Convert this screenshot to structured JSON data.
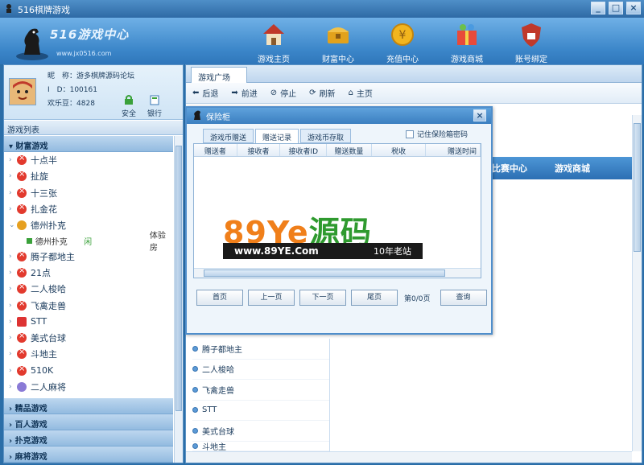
{
  "window": {
    "title": "516棋牌游戏",
    "buttons": [
      "_",
      "□",
      "×"
    ]
  },
  "logo": {
    "title": "516游戏中心",
    "url": "www.jx0516.com"
  },
  "nav": [
    {
      "label": "游戏主页",
      "icon": "house-icon"
    },
    {
      "label": "财富中心",
      "icon": "treasure-chest-icon"
    },
    {
      "label": "充值中心",
      "icon": "coin-icon"
    },
    {
      "label": "游戏商城",
      "icon": "gift-shop-icon"
    },
    {
      "label": "账号绑定",
      "icon": "lock-shield-icon"
    }
  ],
  "user": {
    "nickname_label": "昵　称：",
    "nickname": "游多棋牌源码论坛",
    "id_label": "I　D：",
    "id": "100161",
    "beans_label": "欢乐豆：",
    "beans": "4828",
    "safe_label": "安全",
    "bank_label": "银行"
  },
  "gamelist": {
    "header": "游戏列表",
    "fortune_cat": "财富游戏",
    "items": [
      {
        "label": "十点半",
        "icon": "red"
      },
      {
        "label": "扯旋",
        "icon": "red"
      },
      {
        "label": "十三张",
        "icon": "red"
      },
      {
        "label": "扎金花",
        "icon": "red"
      },
      {
        "label": "德州扑克",
        "icon": "orange",
        "expanded": true
      }
    ],
    "sub": {
      "label": "德州扑克",
      "status": "闲",
      "room": "体验房"
    },
    "items2": [
      {
        "label": "腾子都地主",
        "icon": "red"
      },
      {
        "label": "21点",
        "icon": "red"
      },
      {
        "label": "二人梭哈",
        "icon": "red"
      },
      {
        "label": "飞禽走兽",
        "icon": "red"
      },
      {
        "label": "STT",
        "icon": "stt"
      },
      {
        "label": "美式台球",
        "icon": "red"
      },
      {
        "label": "斗地主",
        "icon": "red"
      },
      {
        "label": "510K",
        "icon": "red"
      },
      {
        "label": "二人麻将",
        "icon": "mahjong"
      }
    ],
    "categories": [
      "精品游戏",
      "百人游戏",
      "扑克游戏",
      "麻将游戏"
    ]
  },
  "browser": {
    "tab": "游戏广场",
    "toolbar": [
      "后退",
      "前进",
      "停止",
      "刷新",
      "主页"
    ],
    "menu": [
      "比赛中心",
      "游戏商城"
    ],
    "list": [
      "腾子都地主",
      "二人梭哈",
      "飞禽走兽",
      "STT",
      "美式台球",
      "斗地主"
    ]
  },
  "dialog": {
    "title": "保险柜",
    "tabs": [
      "游戏币赠送",
      "赠送记录",
      "游戏币存取"
    ],
    "active_tab": "赠送记录",
    "remember": "记住保险箱密码",
    "columns": [
      "赠送者",
      "接收者",
      "接收者ID",
      "赠送数量",
      "税收",
      "赠送时间"
    ],
    "buttons": {
      "first": "首页",
      "prev": "上一页",
      "next": "下一页",
      "last": "尾页",
      "page": "第0/0页",
      "query": "查询"
    }
  },
  "watermark": {
    "brand_latin": "89Ye",
    "brand_cn": "源码",
    "url": "www.89YE.Com",
    "slogan": "10年老站"
  },
  "colors": {
    "accent": "#2f76ba",
    "orange": "#f07f1a",
    "green": "#2f9a2f",
    "red": "#e23a2e"
  }
}
